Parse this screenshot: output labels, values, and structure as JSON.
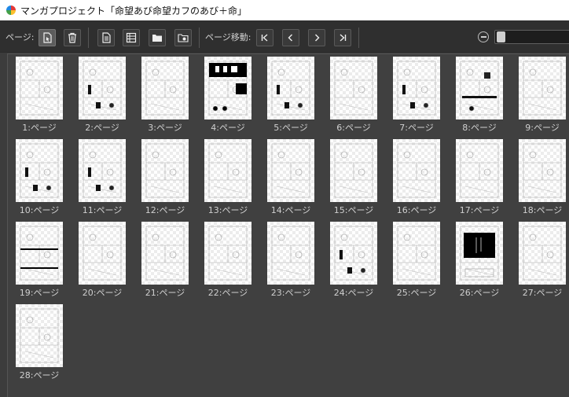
{
  "window": {
    "title": "マンガプロジェクト「命望あび命望カフのあび＋命」"
  },
  "toolbar": {
    "page_label": "ページ:",
    "move_label": "ページ移動:"
  },
  "pages": [
    {
      "label": "1:ページ",
      "style": 0
    },
    {
      "label": "2:ページ",
      "style": 1
    },
    {
      "label": "3:ページ",
      "style": 0
    },
    {
      "label": "4:ページ",
      "style": 2
    },
    {
      "label": "5:ページ",
      "style": 1
    },
    {
      "label": "6:ページ",
      "style": 0
    },
    {
      "label": "7:ページ",
      "style": 1
    },
    {
      "label": "8:ページ",
      "style": 3
    },
    {
      "label": "9:ページ",
      "style": 0
    },
    {
      "label": "10:ページ",
      "style": 1
    },
    {
      "label": "11:ページ",
      "style": 1
    },
    {
      "label": "12:ページ",
      "style": 0
    },
    {
      "label": "13:ページ",
      "style": 0
    },
    {
      "label": "14:ページ",
      "style": 0
    },
    {
      "label": "15:ページ",
      "style": 0
    },
    {
      "label": "16:ページ",
      "style": 0
    },
    {
      "label": "17:ページ",
      "style": 0
    },
    {
      "label": "18:ページ",
      "style": 0
    },
    {
      "label": "19:ページ",
      "style": 4
    },
    {
      "label": "20:ページ",
      "style": 0
    },
    {
      "label": "21:ページ",
      "style": 0
    },
    {
      "label": "22:ページ",
      "style": 0
    },
    {
      "label": "23:ページ",
      "style": 0
    },
    {
      "label": "24:ページ",
      "style": 1
    },
    {
      "label": "25:ページ",
      "style": 0
    },
    {
      "label": "26:ページ",
      "style": 5
    },
    {
      "label": "27:ページ",
      "style": 0
    },
    {
      "label": "28:ページ",
      "style": 0
    }
  ],
  "colors": {
    "toolbar_bg": "#2f2f2f",
    "panel_bg": "#404040",
    "label_text": "#cfcfcf"
  }
}
